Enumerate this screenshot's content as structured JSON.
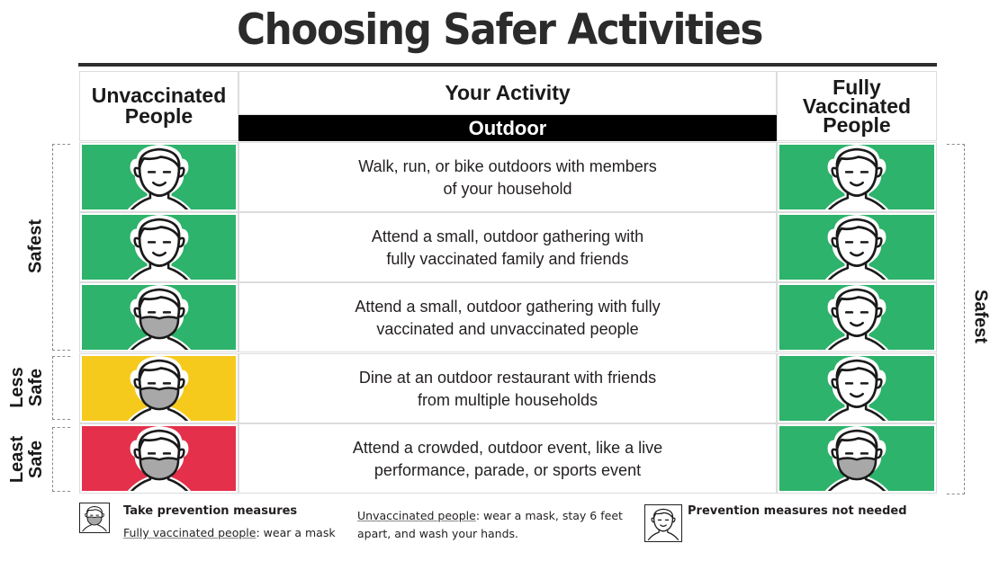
{
  "title": "Choosing Safer Activities",
  "header": {
    "left": [
      "Unvaccinated",
      "People"
    ],
    "middle": "Your Activity",
    "middle_sub": "Outdoor",
    "right": [
      "Fully",
      "Vaccinated",
      "People"
    ]
  },
  "colors": {
    "green": "#2db36b",
    "yellow": "#f6ca1d",
    "red": "#e4304a",
    "mask": "#a8a8a8"
  },
  "rows": [
    {
      "activity": [
        "Walk, run, or bike outdoors with members",
        "of your household"
      ],
      "unvaccinated": {
        "color": "green",
        "mask": false
      },
      "vaccinated": {
        "color": "green",
        "mask": false
      }
    },
    {
      "activity": [
        "Attend a small, outdoor gathering with",
        "fully vaccinated family and friends"
      ],
      "unvaccinated": {
        "color": "green",
        "mask": false
      },
      "vaccinated": {
        "color": "green",
        "mask": false
      }
    },
    {
      "activity": [
        "Attend a small, outdoor gathering with fully",
        "vaccinated and unvaccinated people"
      ],
      "unvaccinated": {
        "color": "green",
        "mask": true
      },
      "vaccinated": {
        "color": "green",
        "mask": false
      }
    },
    {
      "activity": [
        "Dine at an outdoor restaurant with friends",
        "from multiple households"
      ],
      "unvaccinated": {
        "color": "yellow",
        "mask": true
      },
      "vaccinated": {
        "color": "green",
        "mask": false
      }
    },
    {
      "activity": [
        "Attend a crowded, outdoor event, like a live",
        "performance, parade, or sports event"
      ],
      "unvaccinated": {
        "color": "red",
        "mask": true
      },
      "vaccinated": {
        "color": "green",
        "mask": true
      }
    }
  ],
  "left_scale": [
    {
      "label": "Safest"
    },
    {
      "label_lines": [
        "Less",
        "Safe"
      ]
    },
    {
      "label_lines": [
        "Least",
        "Safe"
      ]
    }
  ],
  "right_scale": {
    "label": "Safest"
  },
  "legend": {
    "prevention": {
      "icon": "masked-face-icon",
      "title": "Take prevention measures",
      "vaccinated_label": "Fully vaccinated people",
      "vaccinated_text": ": wear a mask",
      "unvaccinated_label": "Unvaccinated people",
      "unvaccinated_text": ": wear a mask, stay 6 feet",
      "unvaccinated_text2": "apart, and wash your hands."
    },
    "not_needed": {
      "icon": "smiling-face-icon",
      "title": "Prevention measures not needed"
    }
  }
}
